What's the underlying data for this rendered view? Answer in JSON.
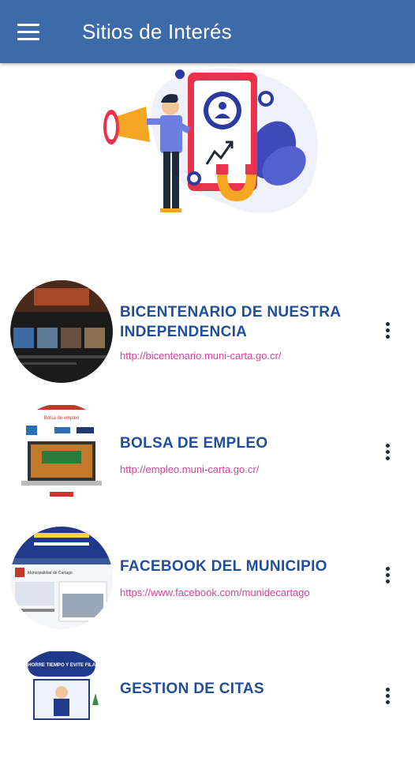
{
  "appbar": {
    "title": "Sitios de Interés",
    "menu_icon": "hamburger-menu-icon"
  },
  "items": [
    {
      "title": "BICENTENARIO DE NUESTRA INDEPENDENCIA",
      "link": "http://bicentenario.muni-carta.go.cr/"
    },
    {
      "title": "BOLSA DE EMPLEO",
      "link": "http://empleo.muni-carta.go.cr/"
    },
    {
      "title": "FACEBOOK DEL MUNICIPIO",
      "link": "https://www.facebook.com/munidecartago"
    },
    {
      "title": "GESTION DE CITAS",
      "link": ""
    }
  ],
  "thumb_texts": {
    "empleo_heading": "Bolsa de empleo",
    "facebook_page": "Municipalidad de Cartago",
    "citas_banner": "¡AHORRE TIEMPO Y EVITE FILAS!"
  },
  "colors": {
    "appbar": "#3d6aa8",
    "item_title": "#1f4e9c",
    "item_link": "#d2459a"
  }
}
